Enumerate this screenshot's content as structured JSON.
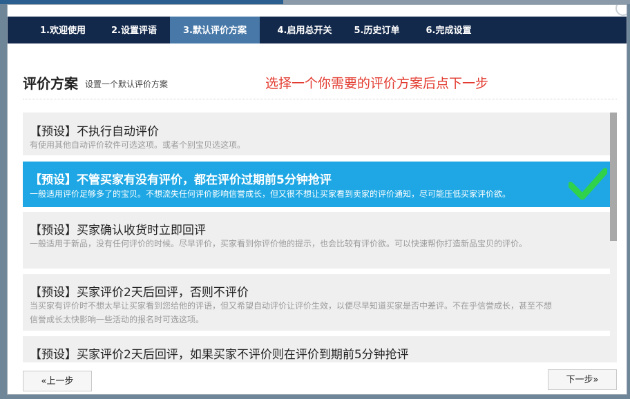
{
  "tabs": [
    {
      "label": "1.欢迎使用"
    },
    {
      "label": "2.设置评语"
    },
    {
      "label": "3.默认评价方案"
    },
    {
      "label": "4.启用总开关"
    },
    {
      "label": "5.历史订单"
    },
    {
      "label": "6.完成设置"
    }
  ],
  "active_tab": "3.默认评价方案",
  "header": {
    "title": "评价方案",
    "subtitle": "设置一个默认评价方案",
    "hint": "选择一个你需要的评价方案后点下一步"
  },
  "options": [
    {
      "title": "【预设】不执行自动评价",
      "desc": "有使用其他自动评价软件可选这项。或者个别宝贝选这项。"
    },
    {
      "title": "【预设】不管买家有没有评价，都在评价过期前5分钟抢评",
      "desc": "一般适用评价足够多了的宝贝。不想流失任何评价影响信誉成长，但又很不想让买家看到卖家的评价通知，尽可能压低买家评价欲。",
      "selected": true
    },
    {
      "title": "【预设】买家确认收货时立即回评",
      "desc": "一般适用于新品，没有任何评价的时候。尽早评价，买家看到你评价他的提示，也会比较有评价欲。可以快速帮你打造新品宝贝的评价。"
    },
    {
      "title": "【预设】买家评价2天后回评，否则不评价",
      "desc": "当买家有评价时不想太早让买家看到您给他的评语，但又希望自动评价让评价生效，以便尽早知道买家是否中差评。不在乎信誉成长，甚至不想信誉成长太快影响一些活动的报名时可选这项。"
    },
    {
      "title": "【预设】买家评价2天后回评，如果买家不评价则在评价到期前5分钟抢评",
      "desc": ""
    }
  ],
  "selected_option_index": 1,
  "buttons": {
    "prev": "«上一步",
    "next": "下一步»"
  },
  "colors": {
    "tab_bar": "#13294b",
    "tab_active": "#4778a8",
    "selected_row": "#1ea7e4",
    "hint_text": "#e23b2f",
    "checkmark": "#2fd24a"
  },
  "icons": {
    "selected_marker": "checkmark-icon"
  }
}
